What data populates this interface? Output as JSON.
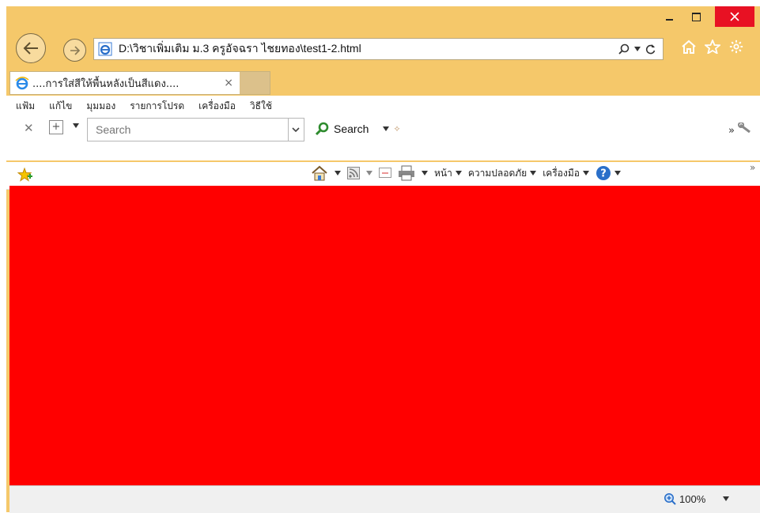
{
  "browser": {
    "address": "D:\\วิชาเพิ่มเติม ม.3 ครูอัจฉรา ไชยทอง\\test1-2.html",
    "tab_title": "....การใส่สีให้พื้นหลังเป็นสีแดง....",
    "tab_close": "×",
    "menu": [
      "แฟ้ม",
      "แก้ไข",
      "มุมมอง",
      "รายการโปรด",
      "เครื่องมือ",
      "วิธีใช้"
    ],
    "search_placeholder": "Search",
    "search_button": "Search",
    "toolbar_more": "»",
    "commands": {
      "page": "หน้า",
      "safety": "ความปลอดภัย",
      "tools": "เครื่องมือ"
    },
    "zoom": "100%"
  },
  "colors": {
    "content_background": "#ff0000",
    "frame": "#f5c86a",
    "close_button": "#e81123"
  },
  "icons": [
    "back-arrow-icon",
    "forward-arrow-icon",
    "ie-page-icon",
    "search-icon",
    "refresh-icon",
    "home-icon",
    "star-icon",
    "gear-icon",
    "add-favorites-icon",
    "feed-icon",
    "mail-icon",
    "print-icon",
    "help-icon",
    "zoom-icon"
  ]
}
